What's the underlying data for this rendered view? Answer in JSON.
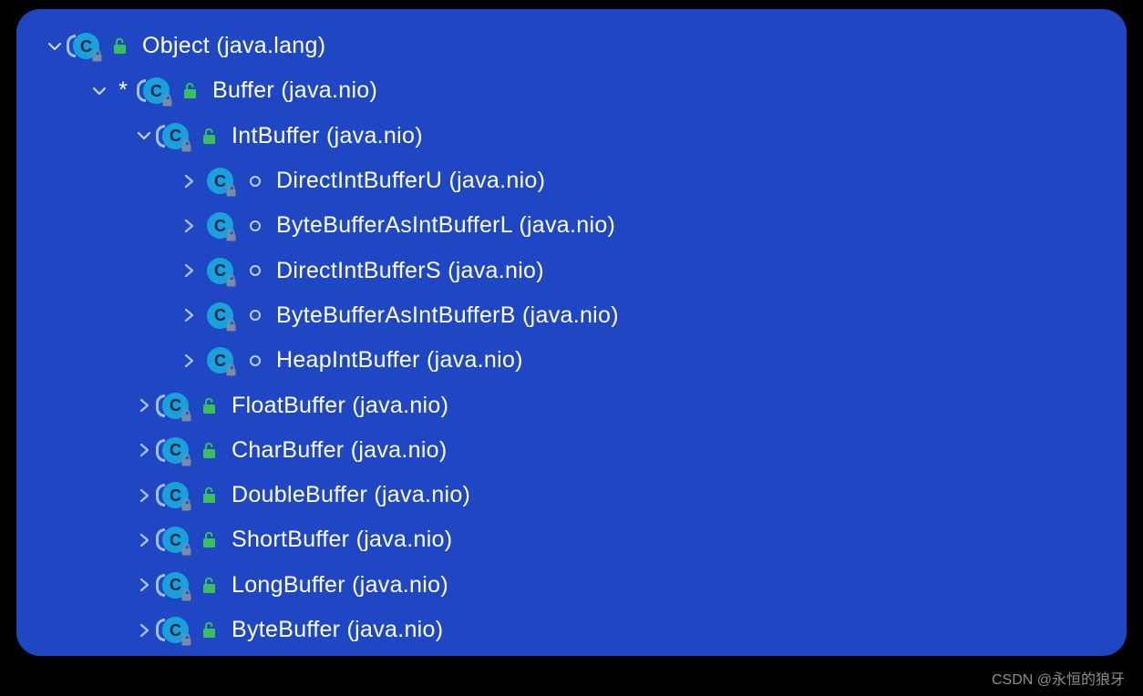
{
  "tree": {
    "n0": {
      "name": "Object",
      "pkg": "(java.lang)"
    },
    "n1": {
      "name": "Buffer",
      "pkg": "(java.nio)"
    },
    "n2": {
      "name": "IntBuffer",
      "pkg": "(java.nio)"
    },
    "n3": {
      "name": "DirectIntBufferU",
      "pkg": "(java.nio)"
    },
    "n4": {
      "name": "ByteBufferAsIntBufferL",
      "pkg": "(java.nio)"
    },
    "n5": {
      "name": "DirectIntBufferS",
      "pkg": "(java.nio)"
    },
    "n6": {
      "name": "ByteBufferAsIntBufferB",
      "pkg": "(java.nio)"
    },
    "n7": {
      "name": "HeapIntBuffer",
      "pkg": "(java.nio)"
    },
    "n8": {
      "name": "FloatBuffer",
      "pkg": "(java.nio)"
    },
    "n9": {
      "name": "CharBuffer",
      "pkg": "(java.nio)"
    },
    "n10": {
      "name": "DoubleBuffer",
      "pkg": "(java.nio)"
    },
    "n11": {
      "name": "ShortBuffer",
      "pkg": "(java.nio)"
    },
    "n12": {
      "name": "LongBuffer",
      "pkg": "(java.nio)"
    },
    "n13": {
      "name": "ByteBuffer",
      "pkg": "(java.nio)"
    }
  },
  "watermark": "CSDN @永恒的狼牙"
}
